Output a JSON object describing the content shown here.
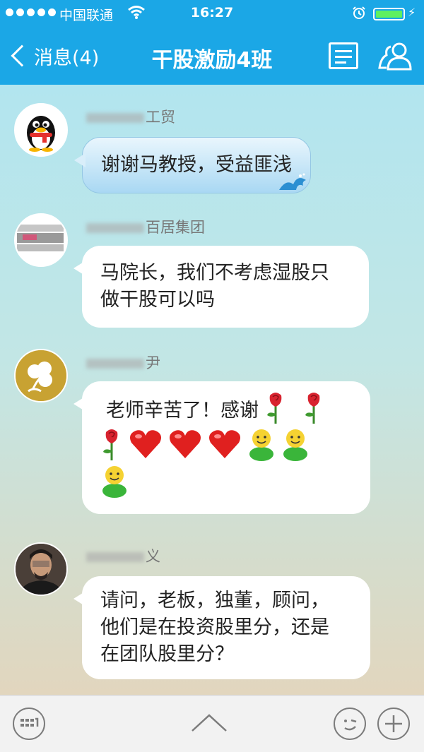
{
  "status_bar": {
    "carrier": "中国联通",
    "time": "16:27",
    "signal_icon": "signal-dots-icon",
    "wifi_icon": "wifi-icon",
    "alarm_icon": "alarm-clock-icon",
    "battery_icon": "battery-icon",
    "charging_icon": "charging-bolt-icon"
  },
  "nav": {
    "back_label": "消息(4)",
    "title": "干股激励4班",
    "doc_icon": "group-notice-icon",
    "members_icon": "group-members-icon"
  },
  "messages": [
    {
      "sender": "工贸",
      "avatar_icon": "penguin-avatar",
      "text": "谢谢马教授，受益匪浅",
      "style": "blue"
    },
    {
      "sender": "百居集团",
      "avatar_icon": "company-logo-avatar",
      "lines": [
        "马院长，我们不考虑湿股只",
        "做干股可以吗"
      ]
    },
    {
      "sender": "尹",
      "avatar_icon": "gold-clover-logo-avatar",
      "text": "老师辛苦了！感谢",
      "emojis": [
        "rose-emoji",
        "rose-emoji",
        "rose-emoji",
        "heart-emoji",
        "heart-emoji",
        "heart-emoji",
        "smiley-figure-emoji",
        "smiley-figure-emoji",
        "smiley-figure-emoji"
      ]
    },
    {
      "sender": "义",
      "avatar_icon": "man-portrait-avatar",
      "lines": [
        "请问，老板，独董，顾问，",
        "他们是在投资股里分，还是",
        "在团队股里分？"
      ]
    }
  ],
  "toolbar": {
    "keyboard_icon": "keyboard-icon",
    "expand_icon": "chevron-up-icon",
    "emoji_icon": "emoji-face-icon",
    "more_icon": "plus-icon"
  },
  "colors": {
    "header_blue": "#1ba7e6",
    "bubble_white": "#ffffff",
    "bubble_blue": "#a9d8f3"
  }
}
